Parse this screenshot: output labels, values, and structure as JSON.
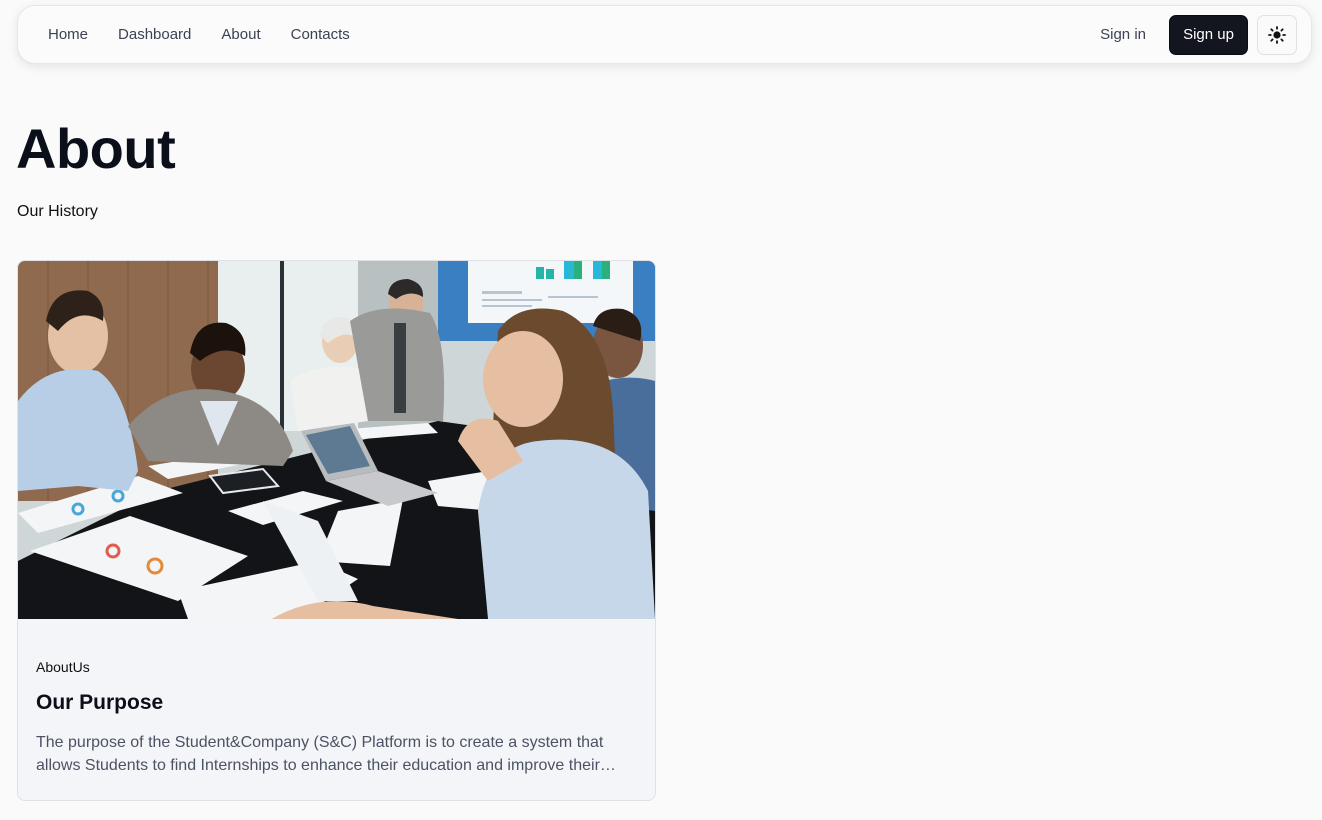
{
  "nav": {
    "links": [
      "Home",
      "Dashboard",
      "About",
      "Contacts"
    ],
    "signin_label": "Sign in",
    "signup_label": "Sign up",
    "theme_icon": "sun-icon"
  },
  "page": {
    "title": "About",
    "subtitle": "Our History"
  },
  "card": {
    "tag": "AboutUs",
    "title": "Our Purpose",
    "description": "The purpose of the Student&Company (S&C) Platform is to create a system that allows Students to find Internships to enhance their education and improve their…"
  },
  "colors": {
    "background": "#fafafa",
    "primary_button": "#13161f",
    "card_background": "#f4f5f8",
    "text_muted": "#4b5263"
  }
}
